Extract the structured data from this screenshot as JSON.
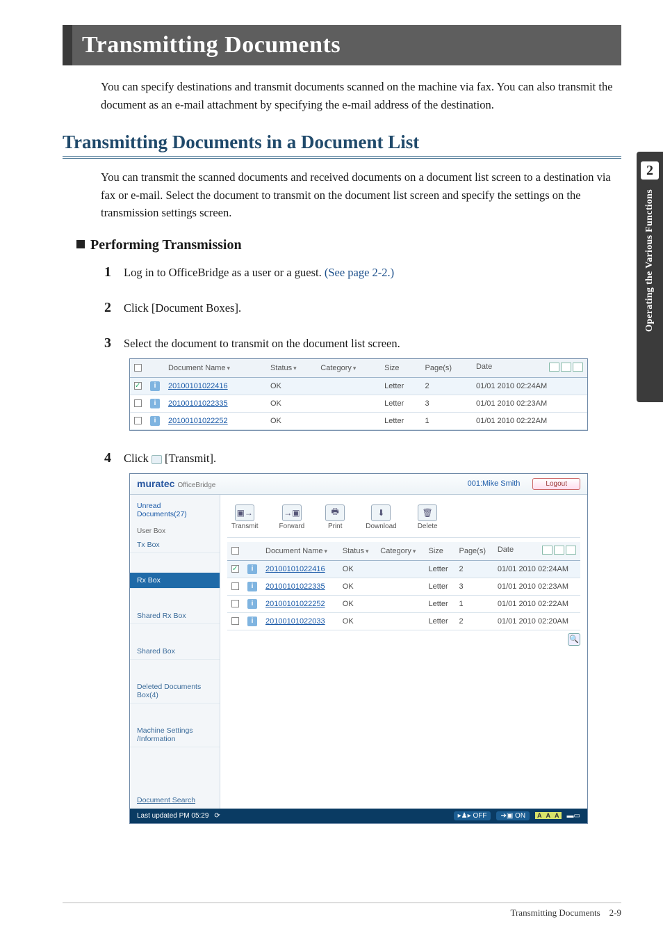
{
  "banner_title": "Transmitting Documents",
  "intro": "You can specify destinations and transmit documents scanned on the machine via fax. You can also transmit the document as an e-mail attachment by specifying the e-mail address of the destination.",
  "section_h2": "Transmitting Documents in a Document List",
  "lead": "You can transmit the scanned documents and received documents on a document list screen to a destination via fax or e-mail. Select the document to transmit on the document list screen and specify the settings on the transmission settings screen.",
  "sub_h3": "Performing Transmission",
  "steps": {
    "s1_a": "Log in to OfficeBridge as a user or a guest. ",
    "s1_link": "(See page 2-2.)",
    "s2": "Click [Document Boxes].",
    "s3": "Select the document to transmit on the document list screen.",
    "s4_a": "Click ",
    "s4_b": " [Transmit]."
  },
  "table_headers": {
    "docname": "Document Name",
    "status": "Status",
    "category": "Category",
    "size": "Size",
    "pages": "Page(s)",
    "date": "Date"
  },
  "doclist_rows": [
    {
      "checked": true,
      "name": "20100101022416",
      "status": "OK",
      "size": "Letter",
      "pages": "2",
      "date": "01/01 2010 02:24AM"
    },
    {
      "checked": false,
      "name": "20100101022335",
      "status": "OK",
      "size": "Letter",
      "pages": "3",
      "date": "01/01 2010 02:23AM"
    },
    {
      "checked": false,
      "name": "20100101022252",
      "status": "OK",
      "size": "Letter",
      "pages": "1",
      "date": "01/01 2010 02:22AM"
    }
  ],
  "ob": {
    "brand": "muratec",
    "brand_sub": "OfficeBridge",
    "user": "001:Mike Smith",
    "logout": "Logout",
    "unread": "Unread Documents(27)",
    "userbox_label": "User Box",
    "side_items": [
      "Tx Box",
      "Rx Box",
      "Shared Rx Box",
      "Shared Box",
      "Deleted Documents Box(4)",
      "Machine Settings /Information"
    ],
    "side_selected_index": 1,
    "search": "Document Search",
    "tools": [
      "Transmit",
      "Forward",
      "Print",
      "Download",
      "Delete"
    ],
    "rows": [
      {
        "checked": true,
        "name": "20100101022416",
        "status": "OK",
        "size": "Letter",
        "pages": "2",
        "date": "01/01 2010 02:24AM"
      },
      {
        "checked": false,
        "name": "20100101022335",
        "status": "OK",
        "size": "Letter",
        "pages": "3",
        "date": "01/01 2010 02:23AM"
      },
      {
        "checked": false,
        "name": "20100101022252",
        "status": "OK",
        "size": "Letter",
        "pages": "1",
        "date": "01/01 2010 02:22AM"
      },
      {
        "checked": false,
        "name": "20100101022033",
        "status": "OK",
        "size": "Letter",
        "pages": "2",
        "date": "01/01 2010 02:20AM"
      }
    ],
    "foot_updated": "Last updated PM 05:29",
    "foot_off": "OFF",
    "foot_on": "ON"
  },
  "side_tab": {
    "chapter": "2",
    "label": "Operating the Various Functions"
  },
  "footer": {
    "title": "Transmitting Documents",
    "page": "2-9"
  }
}
